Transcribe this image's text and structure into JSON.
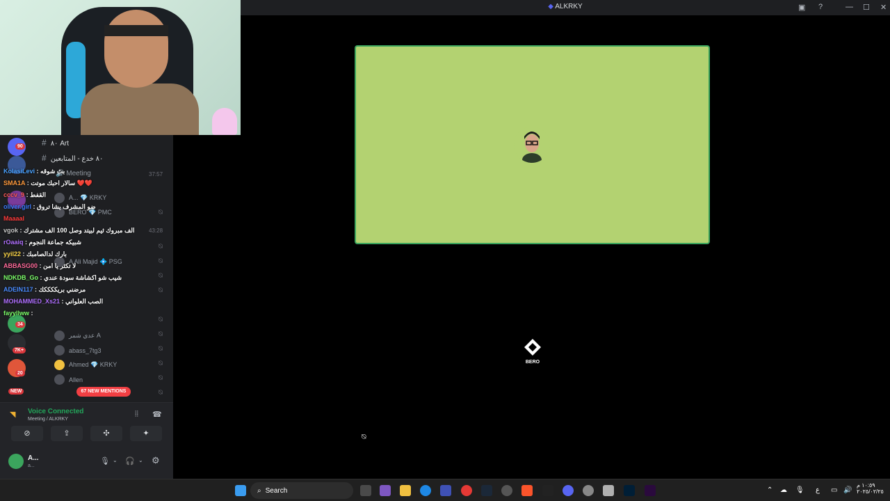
{
  "window": {
    "title": "ALKRKY"
  },
  "channels": [
    {
      "label": "٨٠ Art"
    },
    {
      "label": "٨٠ خدع - المتابعين"
    },
    {
      "label": "Meeting"
    }
  ],
  "guild_badges": [
    "90",
    "34",
    "7K+",
    "20",
    "NEW"
  ],
  "chat": [
    {
      "user": "KolasiLevi",
      "color": "#4aa3ff",
      "msg": ": بث شوقه"
    },
    {
      "user": "SMA1A",
      "color": "#ff9a3c",
      "msg": ": سالار احبك موتت ❤️❤️"
    },
    {
      "user": "cccv_9",
      "color": "#ff5a5a",
      "msg": ": القفط"
    },
    {
      "user": "oliver.girl",
      "color": "#3c7bff",
      "msg": ": ضو المشرف يشا تروق"
    },
    {
      "user": "Maaaal",
      "color": "#ff3c3c",
      "msg": ""
    },
    {
      "user": "vgok",
      "color": "#c8c8c8",
      "msg": ": الف مبروك ثيم لبيتد وصل 100 الف مشترك"
    },
    {
      "user": "rOaaiq",
      "color": "#b070ff",
      "msg": ": شبيكه جماعة النجوم"
    },
    {
      "user": "yyil22",
      "color": "#ffd84a",
      "msg": ": بارك لدالصامبك"
    },
    {
      "user": "ABBASG00",
      "color": "#ff6a9a",
      "msg": ": لا تكثر يا امن"
    },
    {
      "user": "NDKDB_Go",
      "color": "#7dff6a",
      "msg": ": شيب شو اكشاشة سودة عندي"
    },
    {
      "user": "ADEIN117",
      "color": "#4a8cff",
      "msg": ": مرضني بريككككك"
    },
    {
      "user": "MOHAMMED_Xs21",
      "color": "#b070ff",
      "msg": ": الصب العلواني"
    },
    {
      "user": "fayyllww",
      "color": "#7dff6a",
      "msg": ":"
    }
  ],
  "voice_members": [
    {
      "name": "A... 💎 KRKY"
    },
    {
      "name": "BERO 💎 PMC"
    },
    {
      "name": "A Ali Majid 💠 PSG"
    },
    {
      "name": "عدي شمر A"
    },
    {
      "name": "abass_7tg3"
    },
    {
      "name": "Ahmed 💎 KRKY"
    },
    {
      "name": "Allen"
    },
    {
      "name": "A..."
    }
  ],
  "voice_time_1": "37:57",
  "voice_time_2": "43:28",
  "mentions": "67 NEW MENTIONS",
  "voice": {
    "status": "Voice Connected",
    "channel": "Meeting / ALKRKY"
  },
  "user": {
    "name": "A...",
    "sub": "a..."
  },
  "stage": {
    "label": "BERO"
  },
  "taskbar": {
    "search": "Search",
    "time": "١٠:٥٩ م",
    "date": "٢٠٢٥/٠٢/٢٥",
    "lang": "ع"
  }
}
